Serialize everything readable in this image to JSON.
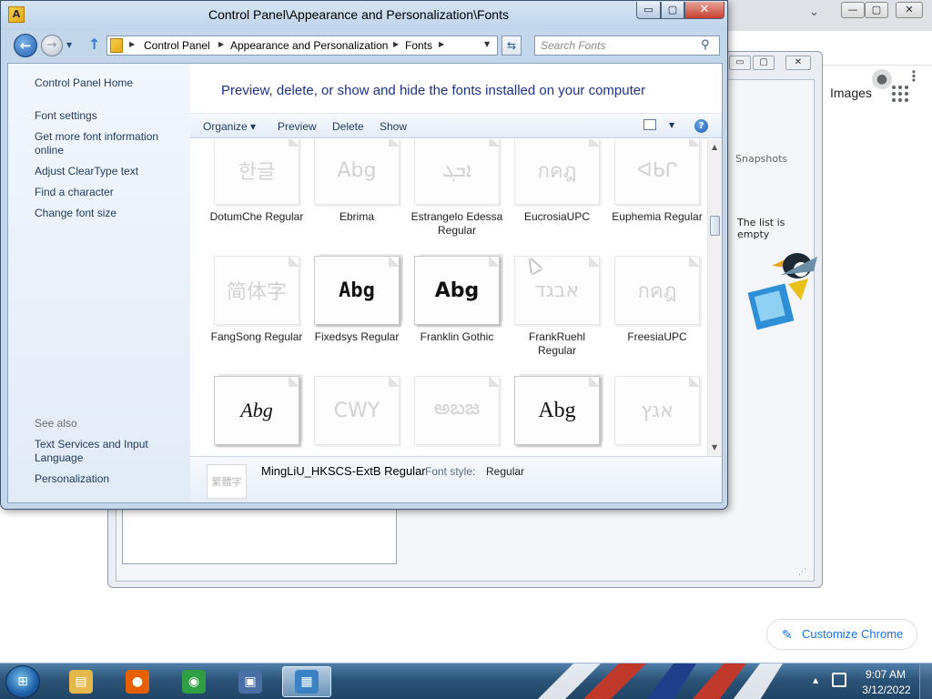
{
  "explorer": {
    "title": "Control Panel\\Appearance and Personalization\\Fonts",
    "title_icon_glyph": "A",
    "buttons": {
      "minimize": "▭",
      "maximize": "▢",
      "close": "✕"
    },
    "address": {
      "crumbs": [
        "Control Panel",
        "Appearance and Personalization",
        "Fonts"
      ]
    },
    "search": {
      "placeholder": "Search Fonts"
    },
    "nav_pane": {
      "home": "Control Panel Home",
      "links": [
        "Font settings",
        "Get more font information online",
        "Adjust ClearType text",
        "Find a character",
        "Change font size"
      ],
      "see_also_heading": "See also",
      "see_also": [
        "Text Services and Input Language",
        "Personalization"
      ]
    },
    "heading": "Preview, delete, or show and hide the fonts installed on your computer",
    "commands": {
      "organize": "Organize",
      "preview": "Preview",
      "delete": "Delete",
      "show": "Show",
      "help": "?"
    },
    "fonts": [
      {
        "name": "DotumChe Regular",
        "sample": "한글",
        "strong": false
      },
      {
        "name": "Ebrima",
        "sample": "Abg",
        "strong": false
      },
      {
        "name": "Estrangelo Edessa Regular",
        "sample": "ܐܒܓ",
        "strong": false
      },
      {
        "name": "EucrosiaUPC",
        "sample": "กคฎ",
        "strong": false
      },
      {
        "name": "Euphemia Regular",
        "sample": "ᐊᑲᒋ",
        "strong": false
      },
      {
        "name": "FangSong Regular",
        "sample": "简体字",
        "strong": false
      },
      {
        "name": "Fixedsys Regular",
        "sample": "Abg",
        "strong": true
      },
      {
        "name": "Franklin Gothic",
        "sample": "Abg",
        "strong": true
      },
      {
        "name": "FrankRuehl Regular",
        "sample": "אבגד",
        "strong": false
      },
      {
        "name": "FreesiaUPC",
        "sample": "กคฎ",
        "strong": false
      },
      {
        "name": "",
        "sample": "Abg",
        "strong": true
      },
      {
        "name": "",
        "sample": "CWY",
        "strong": false
      },
      {
        "name": "",
        "sample": "అబజ",
        "strong": false
      },
      {
        "name": "",
        "sample": "Abg",
        "strong": true
      },
      {
        "name": "",
        "sample": "אגץ",
        "strong": false
      }
    ],
    "details": {
      "thumb": "繁體字",
      "name": "MingLiU_HKSCS-ExtB Regular",
      "style_label": "Font style:",
      "style_value": "Regular"
    }
  },
  "chrome": {
    "images_link": "Images",
    "customize": "Customize Chrome",
    "buttons": {
      "minimize": "—",
      "maximize": "▢",
      "close": "✕"
    }
  },
  "vbox": {
    "snapshots_tab": "Snapshots",
    "empty_list": "The list is empty"
  },
  "taskbar": {
    "apps": [
      {
        "name": "windows-explorer",
        "glyph": "▤",
        "color": "#e4b84a",
        "active": false
      },
      {
        "name": "firefox",
        "glyph": "●",
        "color": "#e66000",
        "active": false
      },
      {
        "name": "chrome",
        "glyph": "◉",
        "color": "#2f9e44",
        "active": false
      },
      {
        "name": "virtualbox",
        "glyph": "▣",
        "color": "#4a6fa5",
        "active": false
      },
      {
        "name": "control-panel",
        "glyph": "▦",
        "color": "#3b82c4",
        "active": true
      }
    ],
    "clock": {
      "time": "9:07 AM",
      "date": "3/12/2022"
    }
  }
}
